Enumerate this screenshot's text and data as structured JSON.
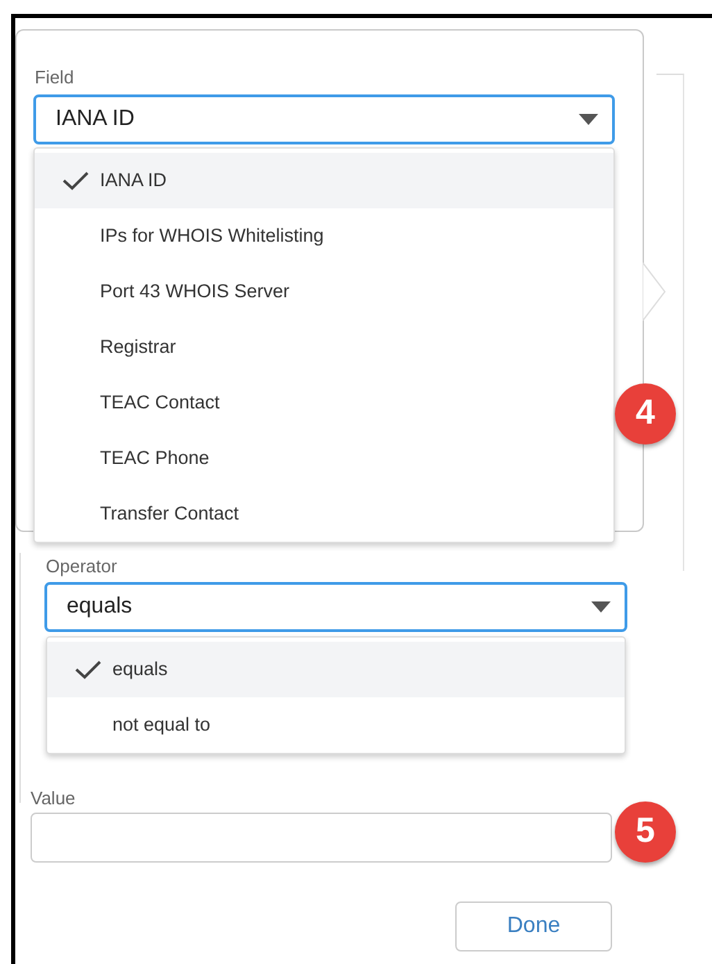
{
  "field": {
    "label": "Field",
    "value": "IANA ID",
    "expanded": true,
    "options": [
      {
        "label": "IANA ID",
        "selected": true
      },
      {
        "label": "IPs for WHOIS Whitelisting",
        "selected": false
      },
      {
        "label": "Port 43 WHOIS Server",
        "selected": false
      },
      {
        "label": "Registrar",
        "selected": false
      },
      {
        "label": "TEAC Contact",
        "selected": false
      },
      {
        "label": "TEAC Phone",
        "selected": false
      },
      {
        "label": "Transfer Contact",
        "selected": false
      }
    ]
  },
  "operator": {
    "label": "Operator",
    "value": "equals",
    "expanded": true,
    "options": [
      {
        "label": "equals",
        "selected": true
      },
      {
        "label": "not equal to",
        "selected": false
      }
    ]
  },
  "value": {
    "label": "Value"
  },
  "done_button": "Done",
  "callouts": [
    {
      "number": "4"
    },
    {
      "number": "5"
    }
  ]
}
